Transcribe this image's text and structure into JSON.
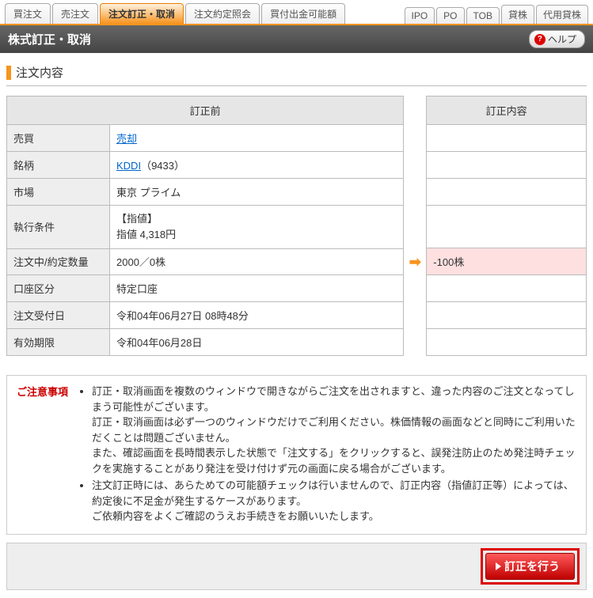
{
  "tabs": {
    "left": [
      "買注文",
      "売注文",
      "注文訂正・取消",
      "注文約定照会",
      "買付出金可能額"
    ],
    "right": [
      "IPO",
      "PO",
      "TOB",
      "貸株",
      "代用貸株"
    ],
    "activeIndex": 2
  },
  "title": "株式訂正・取消",
  "help": "ヘルプ",
  "section": "注文内容",
  "headers": {
    "before": "訂正前",
    "change": "訂正内容"
  },
  "rows": {
    "trade_label": "売買",
    "trade_value": "売却",
    "stock_label": "銘柄",
    "stock_link": "KDDI",
    "stock_code": "（9433）",
    "market_label": "市場",
    "market_value": "東京 プライム",
    "exec_label": "執行条件",
    "exec_line1": "【指値】",
    "exec_line2": "指値 4,318円",
    "qty_label": "注文中/約定数量",
    "qty_value": "2000／0株",
    "qty_change": "-100株",
    "account_label": "口座区分",
    "account_value": "特定口座",
    "received_label": "注文受付日",
    "received_value": "令和04年06月27日 08時48分",
    "expiry_label": "有効期限",
    "expiry_value": "令和04年06月28日"
  },
  "notice_label": "ご注意事項",
  "notices": [
    "訂正・取消画面を複数のウィンドウで開きながらご注文を出されますと、違った内容のご注文となってしまう可能性がございます。\n訂正・取消画面は必ず一つのウィンドウだけでご利用ください。株価情報の画面などと同時にご利用いただくことは問題ございません。\nまた、確認画面を長時間表示した状態で「注文する」をクリックすると、誤発注防止のため発注時チェックを実施することがあり発注を受け付けず元の画面に戻る場合がございます。",
    "注文訂正時には、あらためての可能額チェックは行いませんので、訂正内容（指値訂正等）によっては、約定後に不足金が発生するケースがあります。\nご依頼内容をよくご確認のうえお手続きをお願いいたします。"
  ],
  "submit": "訂正を行う"
}
